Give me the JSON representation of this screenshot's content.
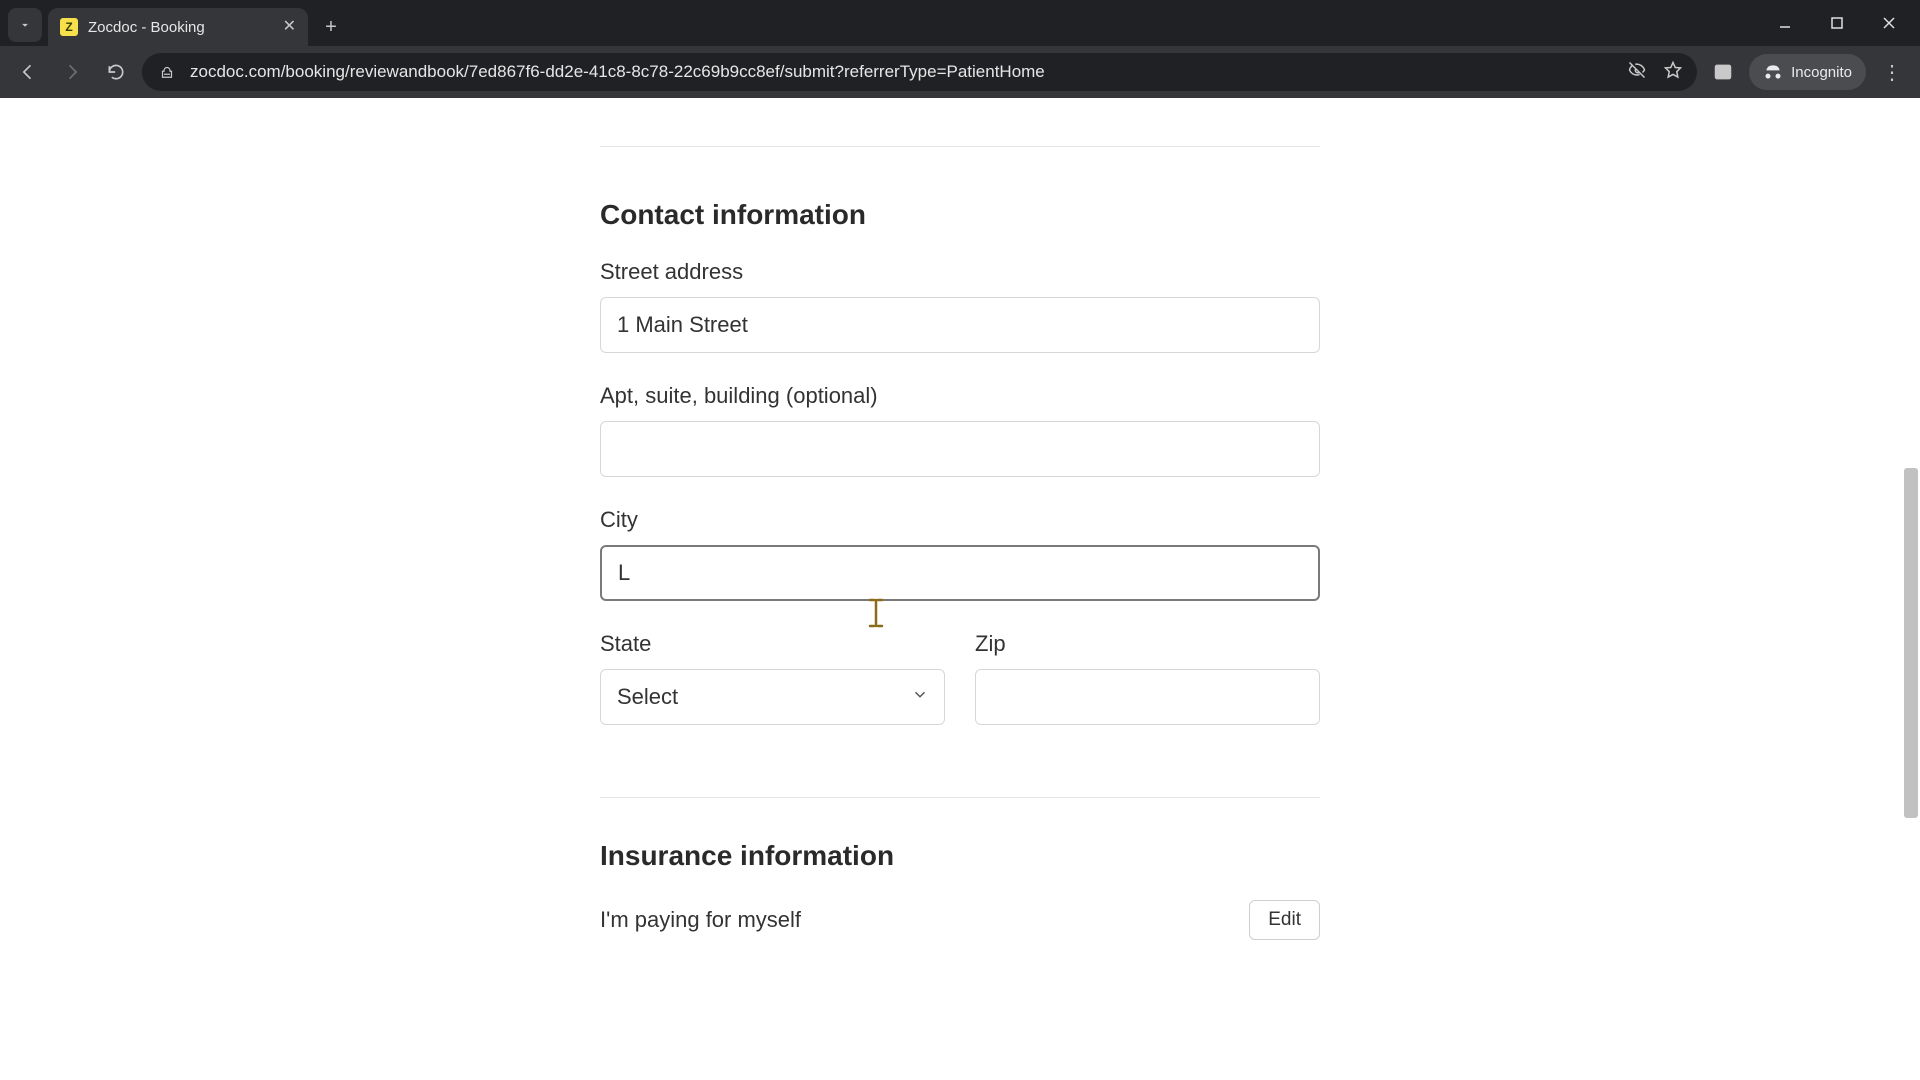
{
  "browser": {
    "tab_title": "Zocdoc - Booking",
    "url": "zocdoc.com/booking/reviewandbook/7ed867f6-dd2e-41c8-8c78-22c69b9cc8ef/submit?referrerType=PatientHome",
    "incognito_label": "Incognito"
  },
  "form": {
    "contact_section_title": "Contact information",
    "street_label": "Street address",
    "street_value": "1 Main Street",
    "apt_label": "Apt, suite, building (optional)",
    "apt_value": "",
    "city_label": "City",
    "city_value": "L",
    "state_label": "State",
    "state_placeholder": "Select",
    "zip_label": "Zip",
    "zip_value": "",
    "insurance_section_title": "Insurance information",
    "insurance_text": "I'm paying for myself",
    "edit_label": "Edit"
  }
}
